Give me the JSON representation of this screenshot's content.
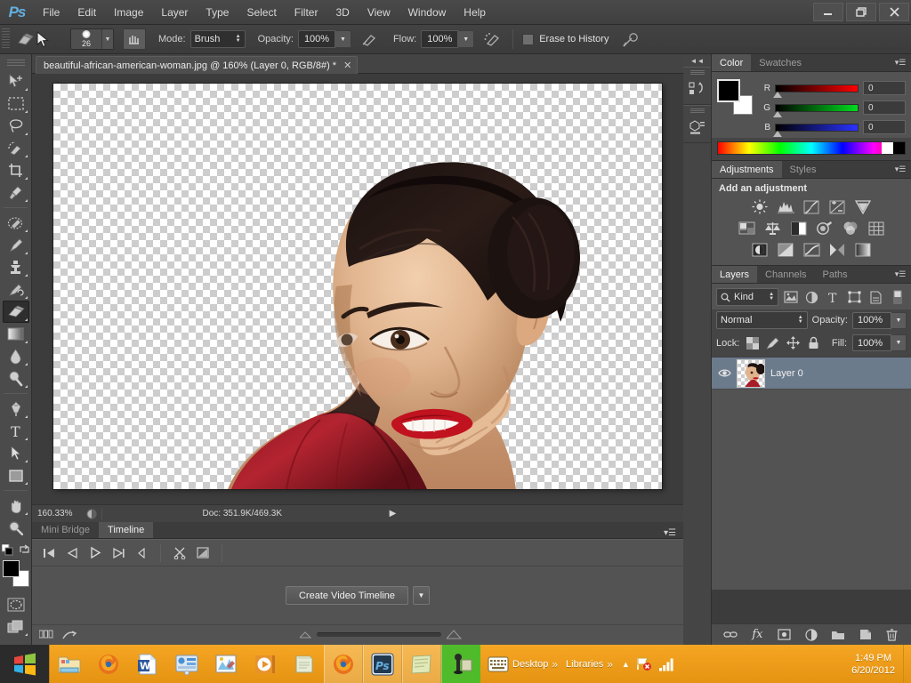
{
  "app": {
    "name": "Ps",
    "logo_color": "#63b0e0"
  },
  "menubar": {
    "items": [
      "File",
      "Edit",
      "Image",
      "Layer",
      "Type",
      "Select",
      "Filter",
      "3D",
      "View",
      "Window",
      "Help"
    ]
  },
  "window_controls": {
    "minimize": "—",
    "restore": "❐",
    "close": "✕"
  },
  "options_bar": {
    "tool_icon": "eraser-icon",
    "brush_size": "26",
    "mode_label": "Mode:",
    "mode_value": "Brush",
    "opacity_label": "Opacity:",
    "opacity_value": "100%",
    "flow_label": "Flow:",
    "flow_value": "100%",
    "airbrush_icon": "airbrush-icon",
    "erase_to_history_label": "Erase to History",
    "tablet_pressure_icon": "tablet-pressure-icon"
  },
  "toolbar": {
    "tools": [
      {
        "name": "move-tool",
        "label": "Move Tool"
      },
      {
        "name": "marquee-tool",
        "label": "Rectangular Marquee Tool"
      },
      {
        "name": "lasso-tool",
        "label": "Lasso Tool"
      },
      {
        "name": "quick-selection-tool",
        "label": "Quick Selection Tool"
      },
      {
        "name": "crop-tool",
        "label": "Crop Tool"
      },
      {
        "name": "eyedropper-tool",
        "label": "Eyedropper Tool"
      },
      {
        "name": "spot-healing-tool",
        "label": "Spot Healing Brush Tool"
      },
      {
        "name": "brush-tool",
        "label": "Brush Tool"
      },
      {
        "name": "clone-stamp-tool",
        "label": "Clone Stamp Tool"
      },
      {
        "name": "history-brush-tool",
        "label": "History Brush Tool"
      },
      {
        "name": "eraser-tool",
        "label": "Eraser Tool"
      },
      {
        "name": "gradient-tool",
        "label": "Gradient Tool"
      },
      {
        "name": "blur-tool",
        "label": "Blur Tool"
      },
      {
        "name": "dodge-tool",
        "label": "Dodge Tool"
      },
      {
        "name": "pen-tool",
        "label": "Pen Tool"
      },
      {
        "name": "type-tool",
        "label": "Horizontal Type Tool"
      },
      {
        "name": "path-selection-tool",
        "label": "Path Selection Tool"
      },
      {
        "name": "rectangle-tool",
        "label": "Rectangle Tool"
      },
      {
        "name": "hand-tool",
        "label": "Hand Tool"
      },
      {
        "name": "zoom-tool",
        "label": "Zoom Tool"
      }
    ],
    "active_tool": "eraser-tool",
    "foreground_color": "#000000",
    "background_color": "#ffffff",
    "quick_mask_label": "Edit in Quick Mask Mode",
    "screen_mode_label": "Change Screen Mode"
  },
  "document": {
    "tab_title": "beautiful-african-american-woman.jpg @ 160% (Layer 0, RGB/8#) *",
    "close_glyph": "✕"
  },
  "status_bar": {
    "zoom": "160.33%",
    "doc_info": "Doc: 351.9K/469.3K",
    "arrow_glyph": "▶"
  },
  "bottom_panel": {
    "tabs": [
      {
        "label": "Mini Bridge",
        "active": false
      },
      {
        "label": "Timeline",
        "active": true
      }
    ],
    "transport": [
      "go-to-first-frame-icon",
      "previous-frame-icon",
      "play-icon",
      "next-frame-icon",
      "set-playhead-icon"
    ],
    "edit_icons": [
      "split-at-playhead-icon",
      "transition-icon"
    ],
    "create_button": "Create Video Timeline",
    "create_dropdown_glyph": "▼",
    "footer_icons": [
      "convert-to-frame-animation-icon",
      "render-video-icon"
    ]
  },
  "dock": {
    "collapse_glyph": "◄◄",
    "icons": [
      "history-panel-icon",
      "properties-panel-icon"
    ]
  },
  "color_panel": {
    "tabs": [
      {
        "label": "Color",
        "active": true
      },
      {
        "label": "Swatches",
        "active": false
      }
    ],
    "menu_glyph": "▾☰",
    "channels": [
      {
        "name": "R",
        "value": "0",
        "from": "#000000",
        "to": "#ff0000"
      },
      {
        "name": "G",
        "value": "0",
        "from": "#000000",
        "to": "#00ff00"
      },
      {
        "name": "B",
        "value": "0",
        "from": "#000000",
        "to": "#0000ff"
      }
    ],
    "foreground": "#000000",
    "background": "#ffffff"
  },
  "adjustments_panel": {
    "tabs": [
      {
        "label": "Adjustments",
        "active": true
      },
      {
        "label": "Styles",
        "active": false
      }
    ],
    "menu_glyph": "▾☰",
    "title": "Add an adjustment",
    "rows": [
      [
        "brightness-contrast-icon",
        "levels-icon",
        "curves-icon",
        "exposure-icon",
        "vibrance-icon"
      ],
      [
        "hue-saturation-icon",
        "color-balance-icon",
        "black-white-icon",
        "photo-filter-icon",
        "channel-mixer-icon",
        "color-lookup-icon"
      ],
      [
        "invert-icon",
        "posterize-icon",
        "threshold-icon",
        "selective-color-icon",
        "gradient-map-icon"
      ]
    ]
  },
  "layers_panel": {
    "tabs": [
      {
        "label": "Layers",
        "active": true
      },
      {
        "label": "Channels",
        "active": false
      },
      {
        "label": "Paths",
        "active": false
      }
    ],
    "menu_glyph": "▾☰",
    "filter_kind": "Kind",
    "filter_icons": [
      "filter-pixel-icon",
      "filter-adjustment-icon",
      "filter-type-icon",
      "filter-shape-icon",
      "filter-smart-object-icon"
    ],
    "filter_toggle_icon": "filter-enable-toggle-icon",
    "blend_mode": "Normal",
    "opacity_label": "Opacity:",
    "opacity_value": "100%",
    "lock_label": "Lock:",
    "lock_icons": [
      "lock-transparency-icon",
      "lock-image-icon",
      "lock-position-icon",
      "lock-all-icon"
    ],
    "fill_label": "Fill:",
    "fill_value": "100%",
    "layers": [
      {
        "name": "Layer 0",
        "visible": true,
        "selected": true
      }
    ],
    "footer_icons": [
      "link-layers-icon",
      "layer-style-fx-icon",
      "add-mask-icon",
      "new-adjustment-layer-icon",
      "new-group-icon",
      "new-layer-icon",
      "delete-layer-icon"
    ],
    "footer_fx_label": "fx"
  },
  "taskbar": {
    "start_label": "start-button",
    "pinned": [
      "windows-explorer-icon",
      "firefox-icon",
      "word-icon",
      "control-panel-icon",
      "paint-icon",
      "media-player-icon",
      "notepad-icon"
    ],
    "running": [
      {
        "icon": "firefox-icon",
        "label": "Mozilla Firefox"
      },
      {
        "icon": "photoshop-icon",
        "label": "Adobe Photoshop"
      },
      {
        "icon": "notes-icon",
        "label": "Sticky Notes"
      },
      {
        "icon": "camtasia-icon",
        "label": "Screen Recorder",
        "highlight": true
      }
    ],
    "toolbars": [
      {
        "label": "Desktop",
        "chevron": "»"
      },
      {
        "label": "Libraries",
        "chevron": "»"
      }
    ],
    "tray_expand_glyph": "▲",
    "tray_icons": [
      "action-center-icon",
      "network-signal-icon"
    ],
    "time": "1:49 PM",
    "date": "6/20/2012"
  }
}
